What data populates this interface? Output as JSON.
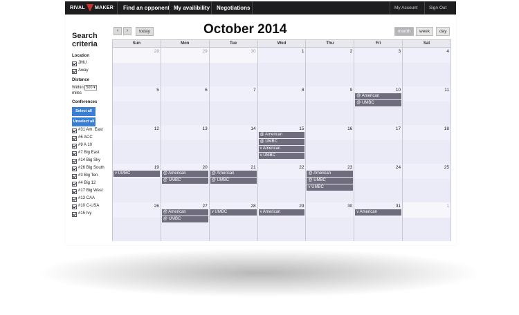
{
  "nav": {
    "logo_left": "RIVAL",
    "logo_right": "MAKER",
    "find_opponent": "Find an opponent",
    "my_availability": "My availibility",
    "negotiations": "Negotiations",
    "my_account": "My Account",
    "sign_out": "Sign Out"
  },
  "sidebar": {
    "title": "Search criteria",
    "location_label": "Location",
    "locations": [
      "JMU",
      "Away"
    ],
    "distance_label": "Distance",
    "within": "Within",
    "distance_value": "500",
    "miles": "miles",
    "conferences_label": "Conferences",
    "select_all": "Select all",
    "unselect_all": "Unselect all",
    "conferences": [
      "#31 Am. East",
      "#6 ACC",
      "#9 A 10",
      "#7 Big East",
      "#14 Big Sky",
      "#26 Big South",
      "#3 Big Ten",
      "#4 Big 12",
      "#17 Big West",
      "#13 CAA",
      "#10 C-USA",
      "#15 Ivy"
    ]
  },
  "calendar": {
    "title": "October 2014",
    "today": "today",
    "prev_icon": "chevron-left",
    "next_icon": "chevron-right",
    "views": [
      "month",
      "week",
      "day"
    ],
    "active_view": "month",
    "days_of_week": [
      "Sun",
      "Mon",
      "Tue",
      "Wed",
      "Thu",
      "Fri",
      "Sat"
    ],
    "weeks": [
      [
        {
          "n": "28",
          "other": true,
          "events": []
        },
        {
          "n": "29",
          "other": true,
          "events": []
        },
        {
          "n": "30",
          "other": true,
          "events": []
        },
        {
          "n": "1",
          "events": []
        },
        {
          "n": "2",
          "events": []
        },
        {
          "n": "3",
          "events": []
        },
        {
          "n": "4",
          "events": []
        }
      ],
      [
        {
          "n": "5",
          "events": []
        },
        {
          "n": "6",
          "events": []
        },
        {
          "n": "7",
          "events": []
        },
        {
          "n": "8",
          "events": []
        },
        {
          "n": "9",
          "events": []
        },
        {
          "n": "10",
          "events": [
            "@ American",
            "@ UMBC"
          ]
        },
        {
          "n": "11",
          "events": []
        }
      ],
      [
        {
          "n": "12",
          "events": []
        },
        {
          "n": "13",
          "events": []
        },
        {
          "n": "14",
          "events": []
        },
        {
          "n": "15",
          "events": [
            "@ American",
            "@ UMBC",
            "v American",
            "v UMBC"
          ]
        },
        {
          "n": "16",
          "events": []
        },
        {
          "n": "17",
          "events": []
        },
        {
          "n": "18",
          "events": []
        }
      ],
      [
        {
          "n": "19",
          "events": [
            "v UMBC"
          ]
        },
        {
          "n": "20",
          "events": [
            "@ American",
            "@ UMBC"
          ]
        },
        {
          "n": "21",
          "events": [
            "@ American",
            "@ UMBC"
          ]
        },
        {
          "n": "22",
          "events": []
        },
        {
          "n": "23",
          "events": [
            "@ American",
            "@ UMBC",
            "v UMBC"
          ]
        },
        {
          "n": "24",
          "events": []
        },
        {
          "n": "25",
          "events": []
        }
      ],
      [
        {
          "n": "26",
          "events": []
        },
        {
          "n": "27",
          "events": [
            "@ American",
            "@ UMBC"
          ]
        },
        {
          "n": "28",
          "events": [
            "v UMBC"
          ]
        },
        {
          "n": "29",
          "events": [
            "v American"
          ]
        },
        {
          "n": "30",
          "events": []
        },
        {
          "n": "31",
          "events": [
            "v American"
          ]
        },
        {
          "n": "1",
          "other": true,
          "events": []
        }
      ]
    ]
  }
}
